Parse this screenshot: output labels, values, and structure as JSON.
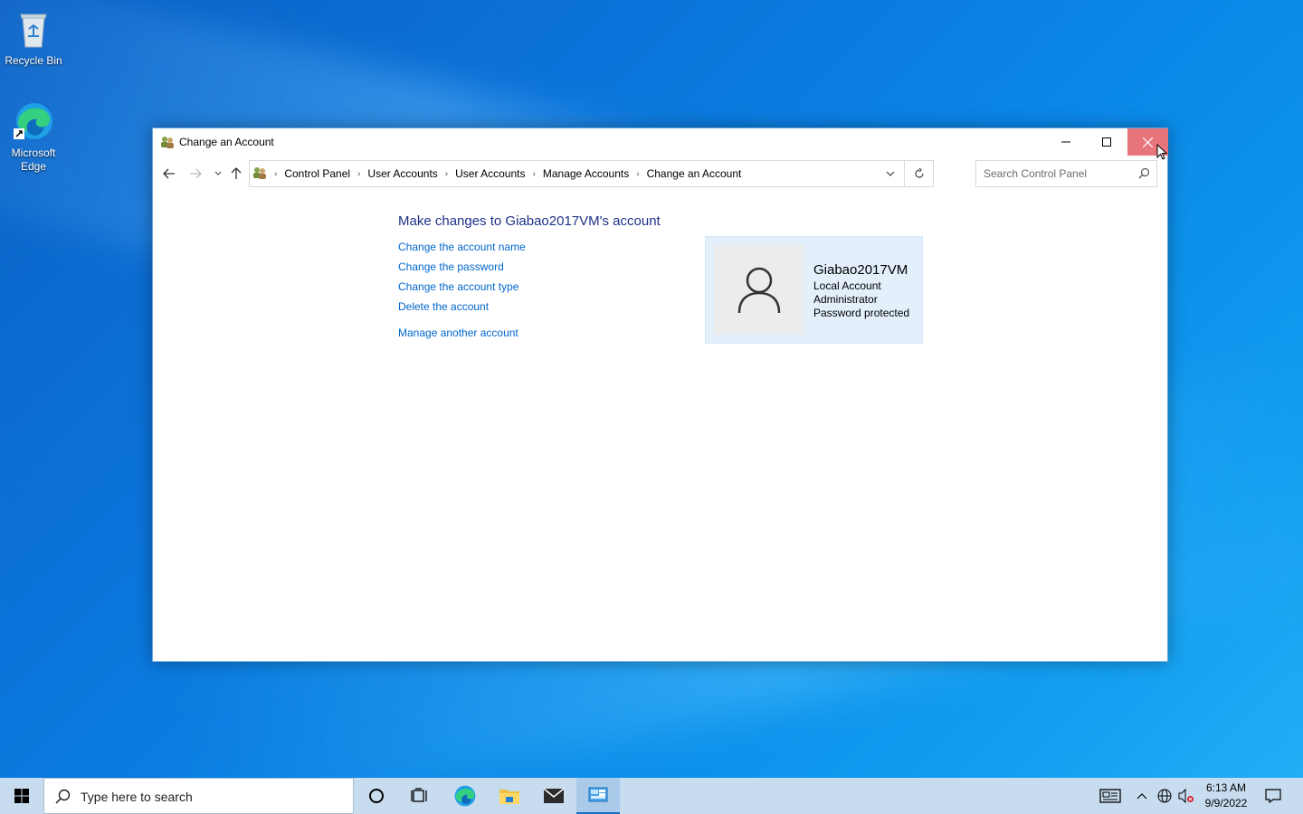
{
  "desktop": {
    "icons": [
      {
        "label": "Recycle Bin",
        "icon": "recycle-bin-icon"
      },
      {
        "label": "Microsoft Edge",
        "icon": "edge-icon"
      }
    ]
  },
  "window": {
    "title": "Change an Account",
    "breadcrumbs": [
      "Control Panel",
      "User Accounts",
      "User Accounts",
      "Manage Accounts",
      "Change an Account"
    ],
    "search_placeholder": "Search Control Panel",
    "heading": "Make changes to Giabao2017VM's account",
    "tasks": [
      "Change the account name",
      "Change the password",
      "Change the account type",
      "Delete the account"
    ],
    "manage_another": "Manage another account",
    "account": {
      "name": "Giabao2017VM",
      "type": "Local Account",
      "role": "Administrator",
      "status": "Password protected"
    },
    "colors": {
      "link": "#0066cc",
      "heading": "#1e3287",
      "close_hover": "#e8747c",
      "card": "#e3f0fb"
    }
  },
  "taskbar": {
    "search_placeholder": "Type here to search",
    "time": "6:13 AM",
    "date": "9/9/2022",
    "pinned": [
      "cortana-icon",
      "task-view-icon",
      "edge-icon",
      "file-explorer-icon",
      "mail-icon",
      "control-panel-icon"
    ]
  }
}
